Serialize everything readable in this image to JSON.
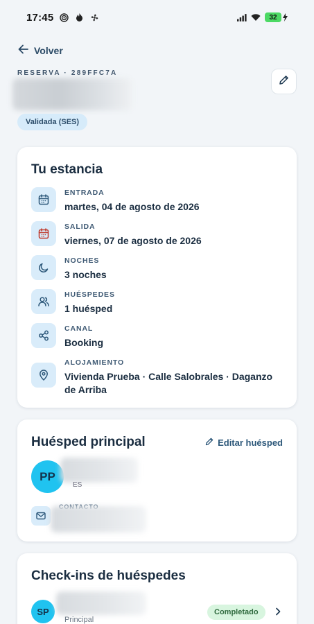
{
  "status_bar": {
    "time": "17:45",
    "battery": "32"
  },
  "header": {
    "back_label": "Volver",
    "reservation_code": "RESERVA · 289FFC7A",
    "status_badge": "Validada (SES)"
  },
  "stay": {
    "title": "Tu estancia",
    "rows": [
      {
        "label": "ENTRADA",
        "value": "martes, 04 de agosto de 2026",
        "icon": "calendar-icon"
      },
      {
        "label": "SALIDA",
        "value": "viernes, 07 de agosto de 2026",
        "icon": "calendar-out-icon"
      },
      {
        "label": "NOCHES",
        "value": "3 noches",
        "icon": "moon-icon"
      },
      {
        "label": "HUÉSPEDES",
        "value": "1 huésped",
        "icon": "users-icon"
      },
      {
        "label": "CANAL",
        "value": "Booking",
        "icon": "share-icon"
      },
      {
        "label": "ALOJAMIENTO",
        "value": "Vivienda Prueba · Calle Salobrales · Daganzo de Arriba",
        "icon": "location-pin-icon"
      }
    ]
  },
  "guest": {
    "title": "Huésped principal",
    "edit_label": "Editar huésped",
    "initials": "PP",
    "country": "ES",
    "contact_label": "CONTACTO"
  },
  "checkins": {
    "title": "Check-ins de huéspedes",
    "initials": "SP",
    "role": "Principal",
    "status": "Completado"
  },
  "colors": {
    "accent": "#20c3f0",
    "icon_bg": "#d9ecfa",
    "badge_bg": "#d6ebfa",
    "success_bg": "#d8f5df",
    "checkout_red": "#c0392b"
  }
}
